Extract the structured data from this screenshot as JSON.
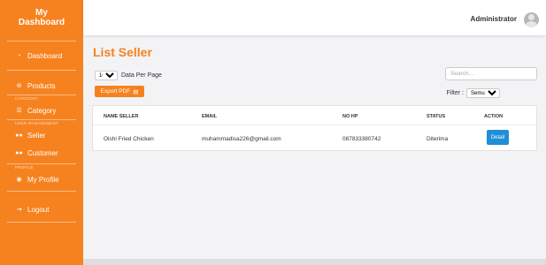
{
  "sidebar": {
    "brand_line1": "My",
    "brand_line2": "Dashboard",
    "items": {
      "dashboard": "Dashboard",
      "products": "Products",
      "category": "Category",
      "seller": "Seller",
      "customer": "Customer",
      "my_profile": "My Profile",
      "logout": "Logout"
    },
    "sections": {
      "category": "CATEGORY",
      "user_management": "USER MANAGEMENT",
      "profile": "PROFILE"
    }
  },
  "topbar": {
    "user_name": "Administrator"
  },
  "page": {
    "title": "List Seller"
  },
  "controls": {
    "per_page_value": "10",
    "per_page_label": "Data Per Page",
    "export_label": "Export PDF",
    "search_placeholder": "Search...",
    "filter_label": "Filter :",
    "filter_value": "Semua"
  },
  "table": {
    "headers": [
      "NAME SELLER",
      "EMAIL",
      "NO HP",
      "STATUS",
      "ACTION"
    ],
    "rows": [
      {
        "name": "Oishi Fried Chicken",
        "email": "muhammadisa226@gmail.com",
        "phone": "087833380742",
        "status": "Diterima",
        "action": "Detail"
      }
    ]
  },
  "colors": {
    "accent": "#f6821f",
    "detail_button": "#1f8fd8"
  }
}
